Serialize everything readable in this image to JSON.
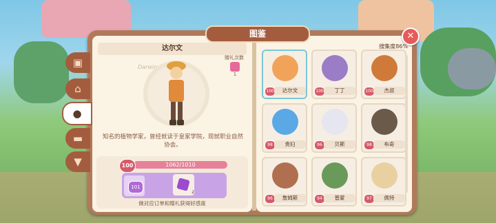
{
  "window": {
    "title": "图鉴"
  },
  "close": {
    "icon": "close-icon"
  },
  "tabs": [
    {
      "icon": "box-icon",
      "active": false
    },
    {
      "icon": "house-icon",
      "active": false
    },
    {
      "icon": "animal-icon",
      "active": true
    },
    {
      "icon": "sofa-icon",
      "active": false
    },
    {
      "icon": "shirt-icon",
      "active": false
    }
  ],
  "detail": {
    "name": "达尔文",
    "gift_label": "赠礼次数",
    "gift_count": "1",
    "description": "知名的植物学家，曾经就读于皇家学院，现就职业自然协会。",
    "affection_level": "100",
    "affection_progress": "1062/1010",
    "affection_fill": 1.0,
    "reward_level": "101",
    "reward_count": "2",
    "reward_tip": "做对应订单和赠礼获得好感度"
  },
  "collection": {
    "label": "搜集度86%",
    "cards": [
      {
        "level": "100",
        "name": "达尔文",
        "color": "#f2a35a",
        "selected": true
      },
      {
        "level": "100",
        "name": "丁丁",
        "color": "#9b7cc6",
        "selected": false
      },
      {
        "level": "100",
        "name": "杰叔",
        "color": "#d07a3a",
        "selected": false
      },
      {
        "level": "98",
        "name": "贵妇",
        "color": "#5aa8e6",
        "selected": false
      },
      {
        "level": "96",
        "name": "贝斯",
        "color": "#e6e6f0",
        "selected": false
      },
      {
        "level": "98",
        "name": "布奇",
        "color": "#6b5a4a",
        "selected": false
      },
      {
        "level": "96",
        "name": "詹姆斯",
        "color": "#b07050",
        "selected": false
      },
      {
        "level": "94",
        "name": "普蒙",
        "color": "#6a9a5a",
        "selected": false
      },
      {
        "level": "97",
        "name": "佩特",
        "color": "#e8d0a0",
        "selected": false
      }
    ]
  }
}
